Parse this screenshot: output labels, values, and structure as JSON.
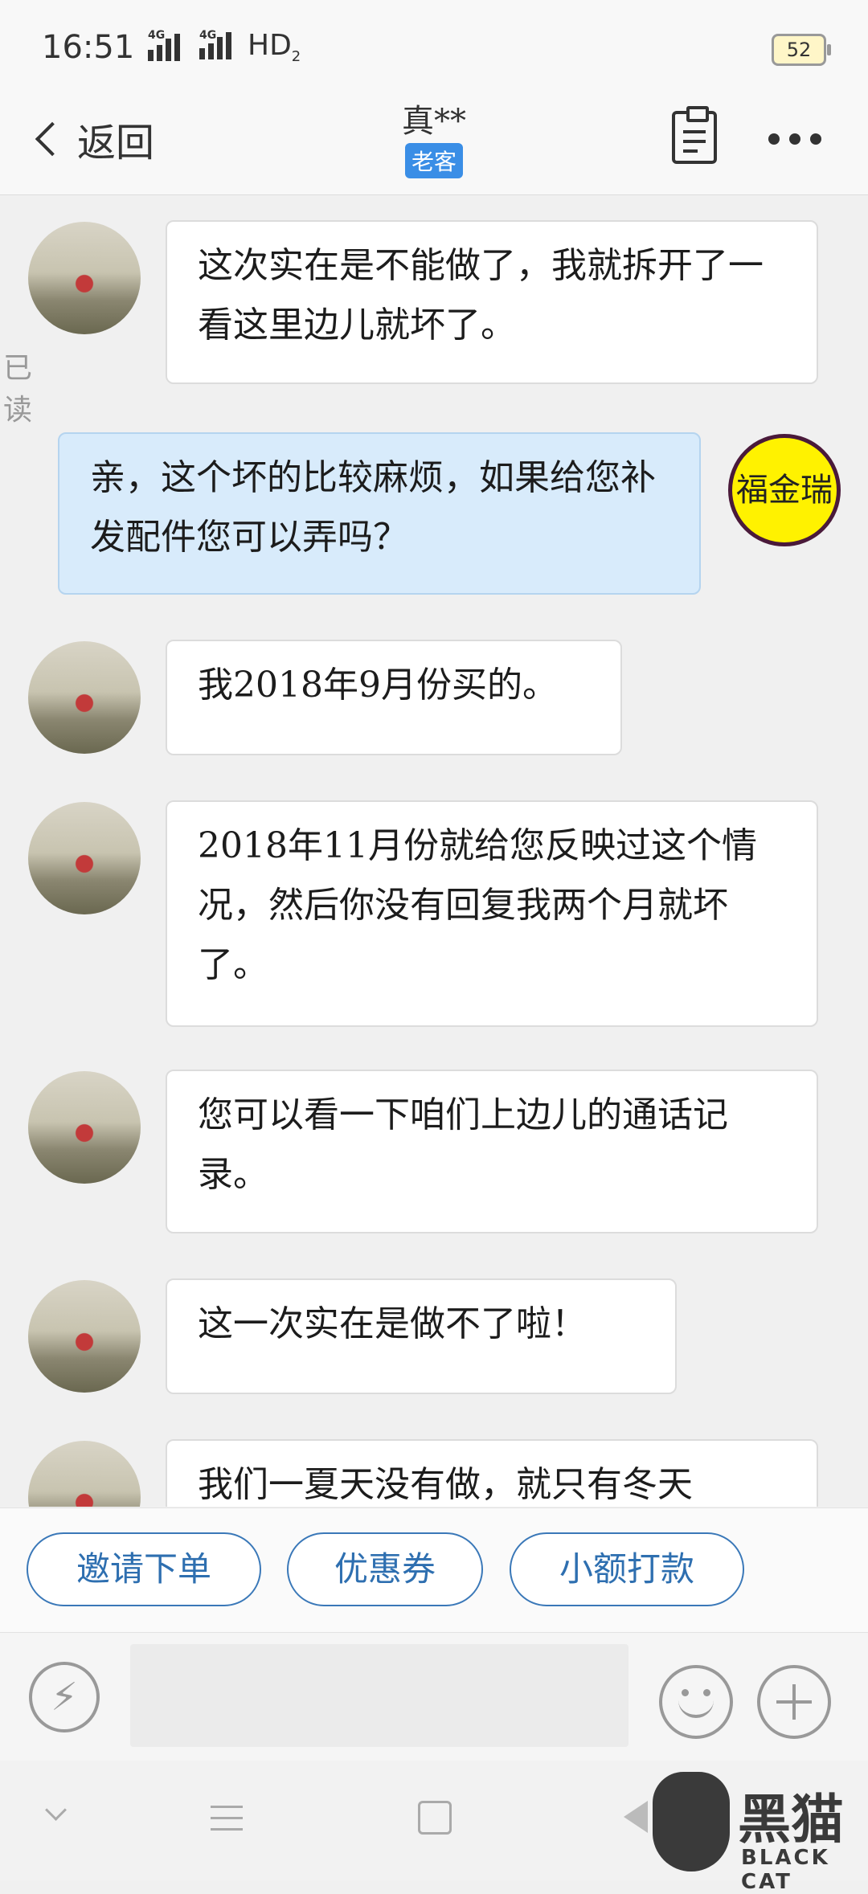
{
  "status_bar": {
    "time": "16:51",
    "net1": "4G",
    "net2": "4G",
    "hd": "HD",
    "hd_sub": "2",
    "battery": "52"
  },
  "header": {
    "back_label": "返回",
    "title": "真**",
    "badge": "老客"
  },
  "messages": [
    {
      "side": "in",
      "text": "这次实在是不能做了，我就拆开了一看这里边儿就坏了。"
    },
    {
      "side": "out",
      "text": "亲，这个坏的比较麻烦，如果给您补发配件您可以弄吗？",
      "read_status": "已读"
    },
    {
      "side": "in",
      "text": "我2018年9月份买的。"
    },
    {
      "side": "in",
      "text": "2018年11月份就给您反映过这个情况，然后你没有回复我两个月就坏了。"
    },
    {
      "side": "in",
      "text": "您可以看一下咱们上边儿的通话记录。"
    },
    {
      "side": "in",
      "text": "这一次实在是做不了啦！"
    },
    {
      "side": "in",
      "text": "我们一夏天没有做，就只有冬天"
    }
  ],
  "shop_avatar_text": "福金瑞",
  "quick_actions": [
    "邀请下单",
    "优惠券",
    "小额打款"
  ],
  "watermark": {
    "text": "黑猫",
    "sub": "BLACK CAT"
  }
}
